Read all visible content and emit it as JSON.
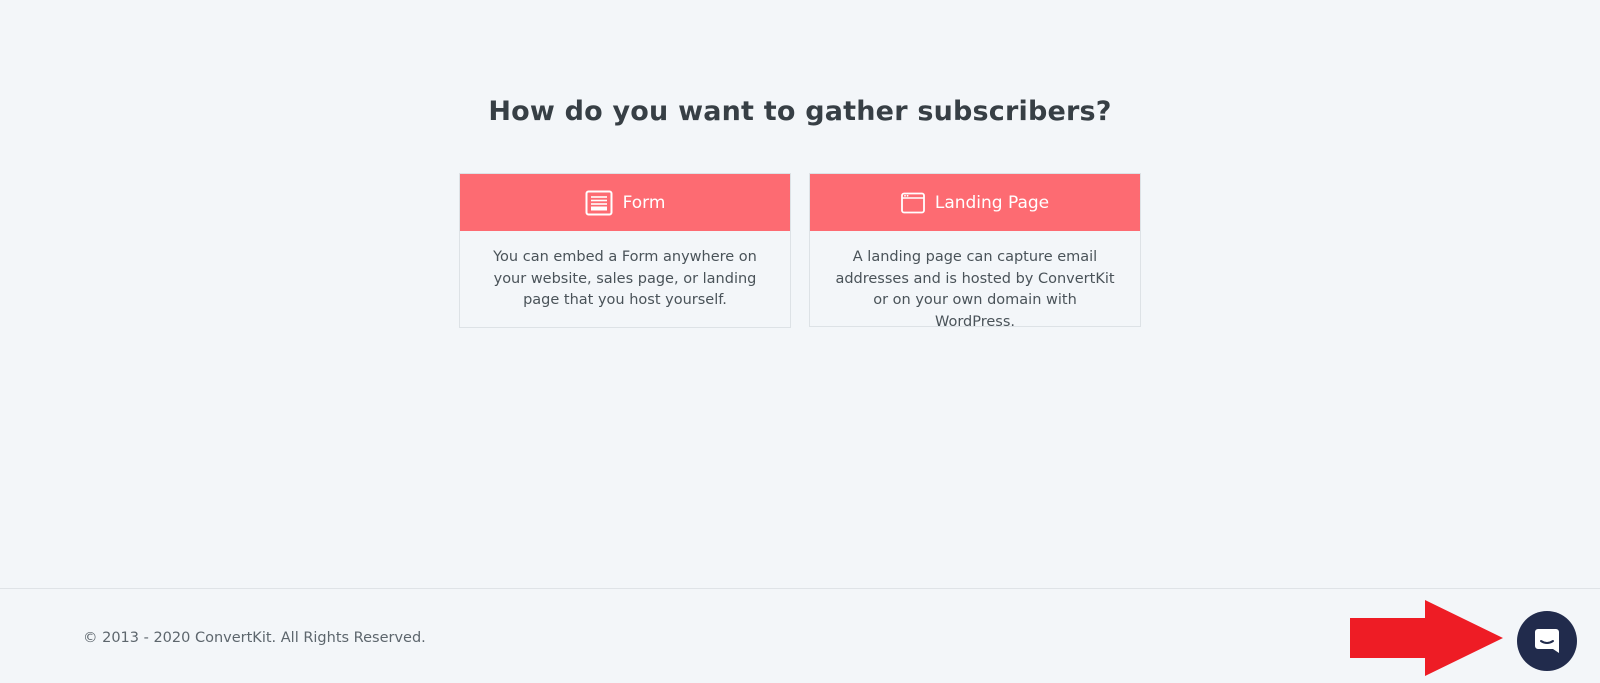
{
  "main": {
    "heading": "How do you want to gather subscribers?",
    "cards": [
      {
        "title": "Form",
        "icon": "form-icon",
        "description": "You can embed a Form anywhere on your website, sales page, or landing page that you host yourself."
      },
      {
        "title": "Landing Page",
        "icon": "browser-window-icon",
        "description": "A landing page can capture email addresses and is hosted by ConvertKit or on your own domain with WordPress."
      }
    ]
  },
  "footer": {
    "copyright": "© 2013 - 2020 ConvertKit. All Rights Reserved."
  },
  "chat_widget": {
    "icon": "chat-icon"
  },
  "colors": {
    "background": "#f3f6f9",
    "card_header": "#fd6b72",
    "chat_button": "#212b4c",
    "annotation_arrow": "#ee1c25",
    "heading_text": "#373f45"
  }
}
